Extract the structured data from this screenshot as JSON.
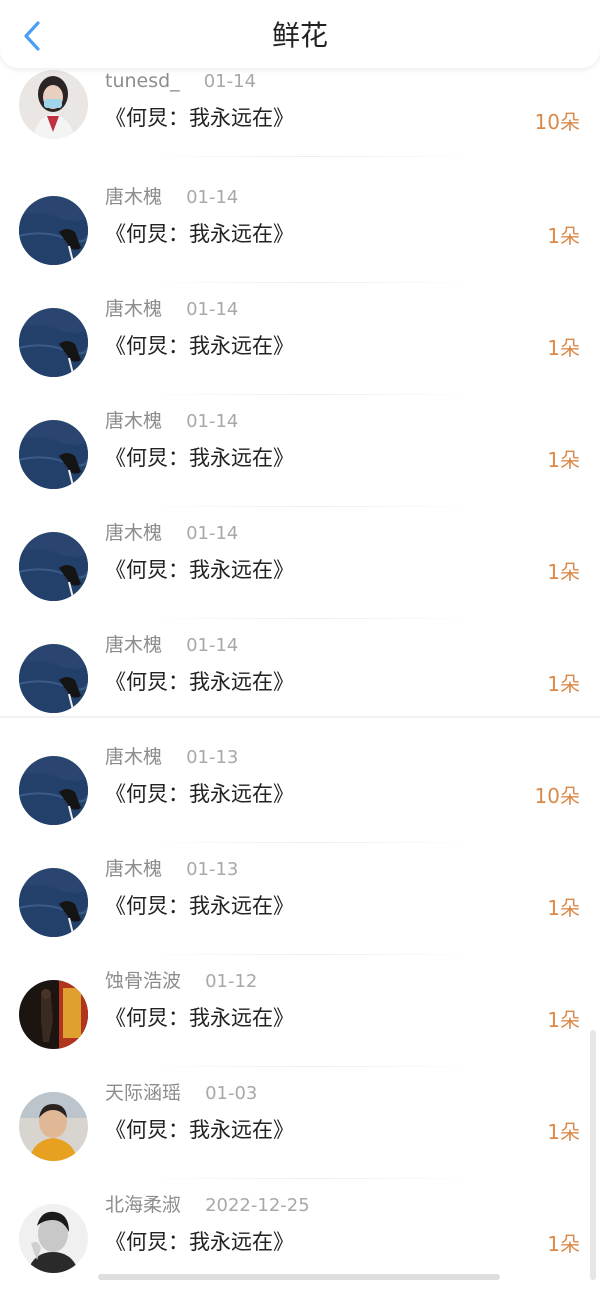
{
  "header": {
    "title": "鲜花"
  },
  "colors": {
    "accent_blue": "#4a9ef5",
    "count_orange": "#d98a4a"
  },
  "icons": {
    "back": "chevron-left-icon"
  },
  "rows": [
    {
      "name": "tunesd_",
      "date": "01-14",
      "book": "《何炅：我永远在》",
      "count": "10朵",
      "avatar": "girl-mask"
    },
    {
      "name": "唐木槐",
      "date": "01-14",
      "book": "《何炅：我永远在》",
      "count": "1朵",
      "avatar": "sea"
    },
    {
      "name": "唐木槐",
      "date": "01-14",
      "book": "《何炅：我永远在》",
      "count": "1朵",
      "avatar": "sea"
    },
    {
      "name": "唐木槐",
      "date": "01-14",
      "book": "《何炅：我永远在》",
      "count": "1朵",
      "avatar": "sea"
    },
    {
      "name": "唐木槐",
      "date": "01-14",
      "book": "《何炅：我永远在》",
      "count": "1朵",
      "avatar": "sea"
    },
    {
      "name": "唐木槐",
      "date": "01-14",
      "book": "《何炅：我永远在》",
      "count": "1朵",
      "avatar": "sea"
    },
    {
      "name": "唐木槐",
      "date": "01-13",
      "book": "《何炅：我永远在》",
      "count": "10朵",
      "avatar": "sea"
    },
    {
      "name": "唐木槐",
      "date": "01-13",
      "book": "《何炅：我永远在》",
      "count": "1朵",
      "avatar": "sea"
    },
    {
      "name": "蚀骨浩波",
      "date": "01-12",
      "book": "《何炅：我永远在》",
      "count": "1朵",
      "avatar": "dark"
    },
    {
      "name": "天际涵瑶",
      "date": "01-03",
      "book": "《何炅：我永远在》",
      "count": "1朵",
      "avatar": "woman"
    },
    {
      "name": "北海柔淑",
      "date": "2022-12-25",
      "book": "《何炅：我永远在》",
      "count": "1朵",
      "avatar": "bw"
    }
  ]
}
